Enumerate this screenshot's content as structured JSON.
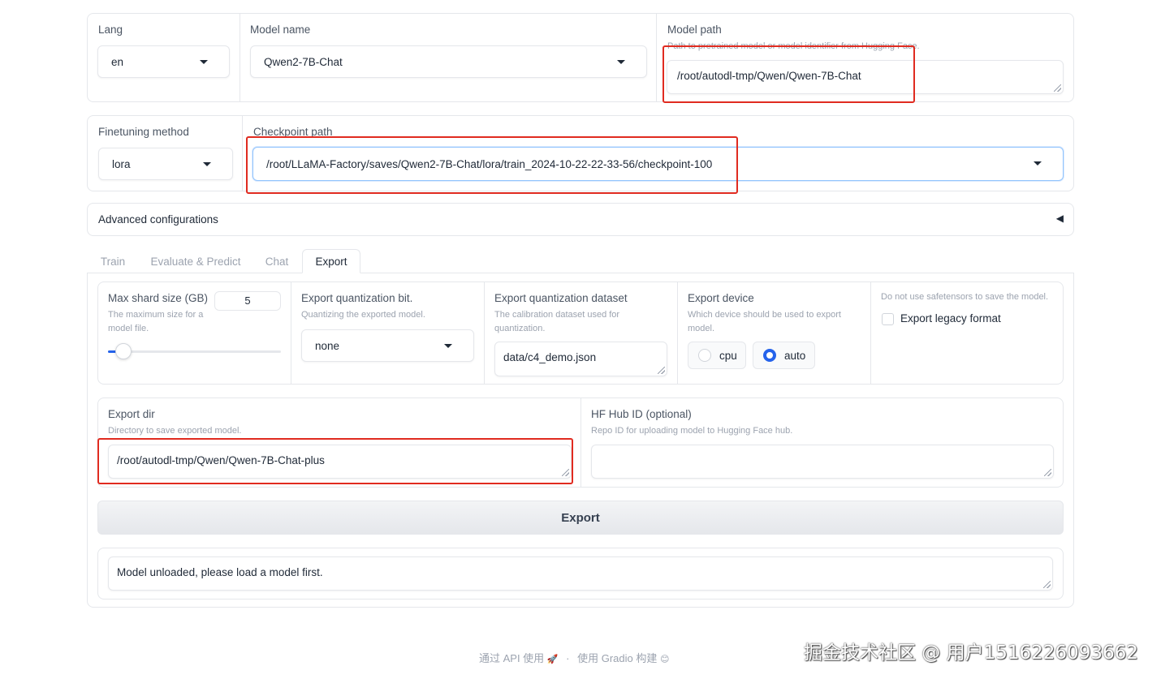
{
  "top": {
    "lang": {
      "label": "Lang",
      "value": "en"
    },
    "model_name": {
      "label": "Model name",
      "value": "Qwen2-7B-Chat"
    },
    "model_path": {
      "label": "Model path",
      "info": "Path to pretrained model or model identifier from Hugging Face.",
      "value": "/root/autodl-tmp/Qwen/Qwen-7B-Chat"
    }
  },
  "second": {
    "finetuning_method": {
      "label": "Finetuning method",
      "value": "lora"
    },
    "checkpoint_path": {
      "label": "Checkpoint path",
      "value": "/root/LLaMA-Factory/saves/Qwen2-7B-Chat/lora/train_2024-10-22-22-33-56/checkpoint-100"
    }
  },
  "advanced": {
    "label": "Advanced configurations",
    "toggle_icon": "◀"
  },
  "tabs": [
    {
      "label": "Train"
    },
    {
      "label": "Evaluate & Predict"
    },
    {
      "label": "Chat"
    },
    {
      "label": "Export"
    }
  ],
  "export": {
    "max_shard": {
      "label": "Max shard size (GB)",
      "info": "The maximum size for a model file.",
      "value": "5",
      "slider_fraction": 0.05
    },
    "quant_bit": {
      "label": "Export quantization bit.",
      "info": "Quantizing the exported model.",
      "value": "none"
    },
    "quant_dataset": {
      "label": "Export quantization dataset",
      "info": "The calibration dataset used for quantization.",
      "value": "data/c4_demo.json"
    },
    "device": {
      "label": "Export device",
      "info": "Which device should be used to export model.",
      "options": [
        "cpu",
        "auto"
      ],
      "selected": "auto"
    },
    "legacy": {
      "info": "Do not use safetensors to save the model.",
      "label": "Export legacy format",
      "checked": false
    },
    "export_dir": {
      "label": "Export dir",
      "info": "Directory to save exported model.",
      "value": "/root/autodl-tmp/Qwen/Qwen-7B-Chat-plus"
    },
    "hub_id": {
      "label": "HF Hub ID (optional)",
      "info": "Repo ID for uploading model to Hugging Face hub.",
      "value": ""
    },
    "button_label": "Export",
    "output": "Model unloaded, please load a model first."
  },
  "footer": {
    "api_text": "通过 API 使用",
    "api_icon": "🚀",
    "separator": "·",
    "gradio_text": "使用 Gradio 构建",
    "gradio_icon": "😊"
  },
  "watermark": "掘金技术社区 @ 用户1516226093662",
  "colors": {
    "accent": "#2563eb",
    "highlight_box": "#e02b20",
    "border": "#e5e7eb"
  }
}
